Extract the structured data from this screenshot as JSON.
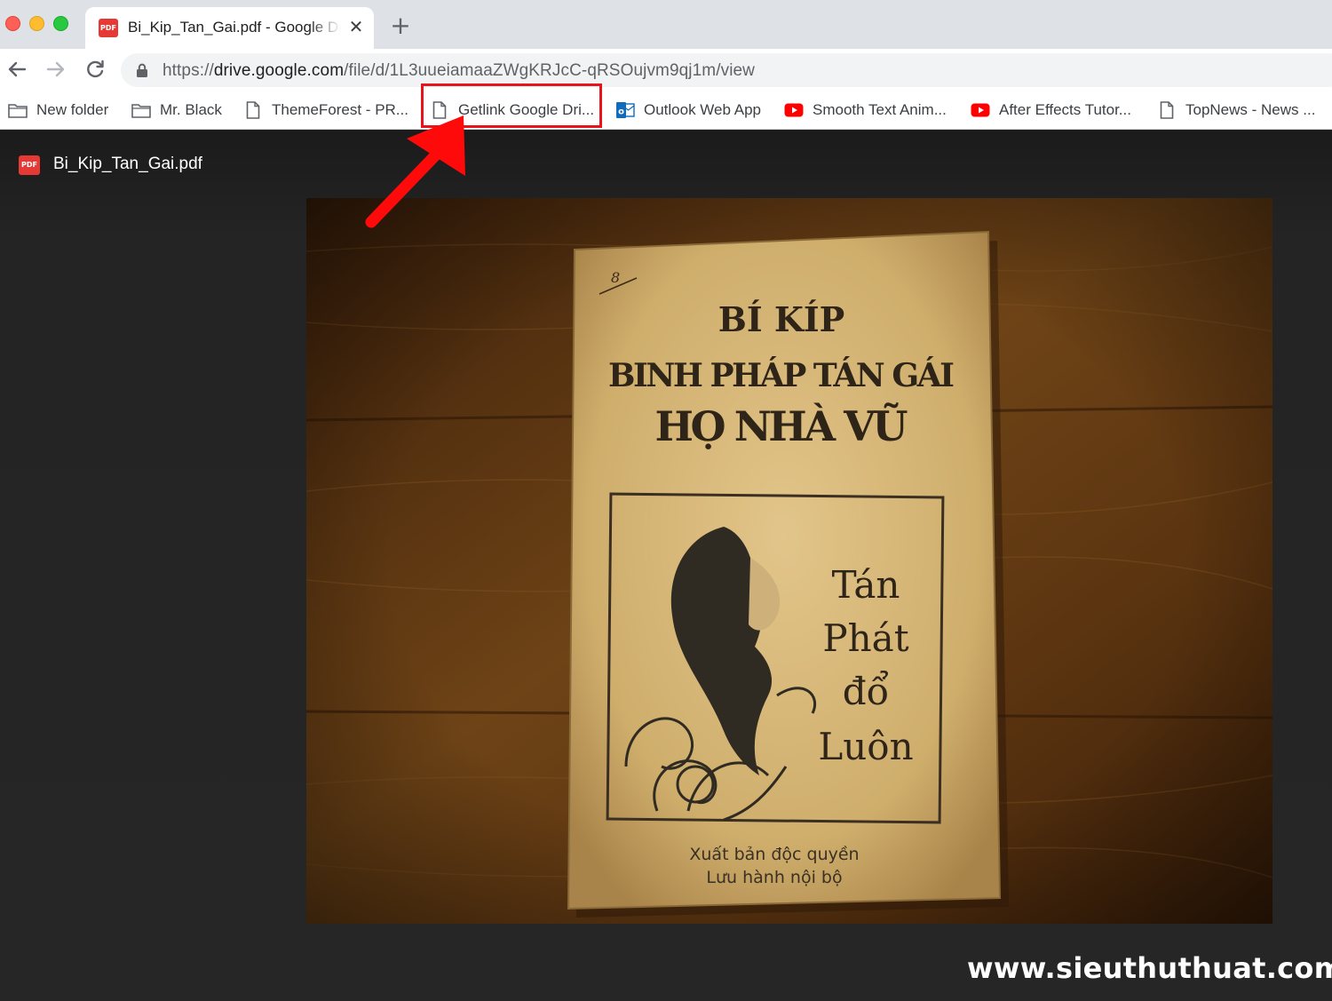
{
  "browser": {
    "tab": {
      "title": "Bi_Kip_Tan_Gai.pdf - Google Drive",
      "icon": "pdf-icon",
      "close_glyph": "✕",
      "pdf_badge": "PDF"
    },
    "new_tab_glyph": "+",
    "address": {
      "scheme": "https://",
      "host": "drive.google.com",
      "path": "/file/d/1L3uueiamaaZWgKRJcC-qRSOujvm9qj1m/view"
    },
    "bookmarks": [
      {
        "label": "New folder",
        "icon": "folder-icon"
      },
      {
        "label": "Mr. Black",
        "icon": "folder-icon"
      },
      {
        "label": "ThemeForest - PR...",
        "icon": "page-icon"
      },
      {
        "label": "Getlink Google Dri...",
        "icon": "page-icon"
      },
      {
        "label": "Outlook Web App",
        "icon": "outlook-icon"
      },
      {
        "label": "Smooth Text Anim...",
        "icon": "youtube-icon"
      },
      {
        "label": "After Effects Tutor...",
        "icon": "youtube-icon"
      },
      {
        "label": "TopNews - News ...",
        "icon": "page-icon"
      }
    ]
  },
  "viewer": {
    "file_name": "Bi_Kip_Tan_Gai.pdf",
    "pdf_badge": "PDF",
    "book": {
      "corner_mark": "8",
      "title_line1": "BÍ KÍP",
      "title_line2": "BINH PHÁP TÁN GÁI",
      "title_line3": "HỌ NHÀ VŨ",
      "side_line1": "Tán",
      "side_line2": "Phát",
      "side_line3": "đổ",
      "side_line4": "Luôn",
      "footer_line1": "Xuất bản độc quyền",
      "footer_line2": "Lưu hành nội bộ"
    }
  },
  "watermark": "www.sieuthuthuat.com",
  "colors": {
    "highlight": "#e8131b",
    "pdf_red": "#e53935",
    "wood": "#5a3410",
    "paper": "#d8b878"
  }
}
